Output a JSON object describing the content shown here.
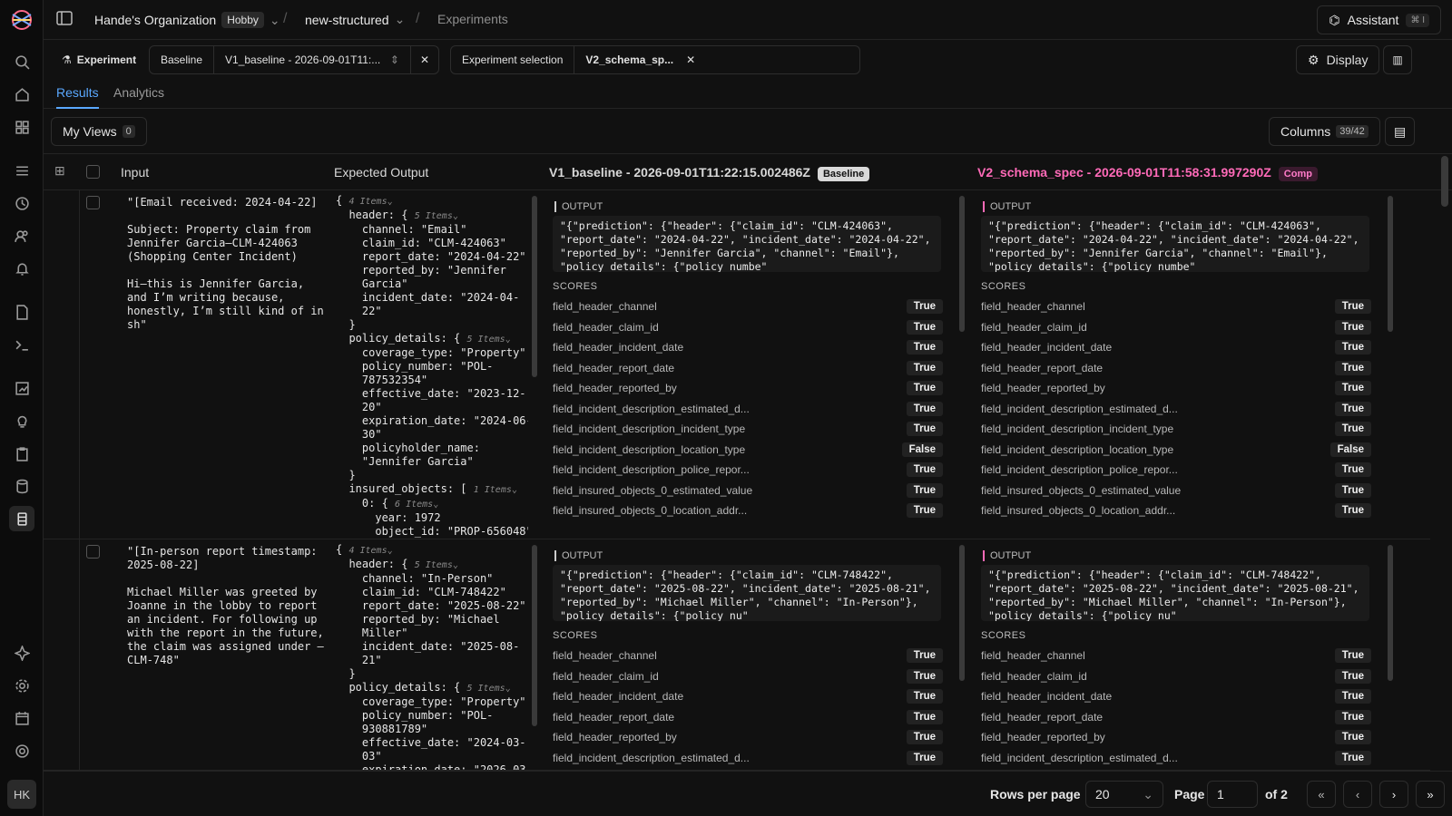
{
  "topbar": {
    "org": "Hande's Organization",
    "plan_badge": "Hobby",
    "project": "new-structured",
    "page": "Experiments",
    "assistant_label": "Assistant",
    "assistant_shortcut": "⌘ I"
  },
  "filters": {
    "experiment_label": "Experiment",
    "baseline_label": "Baseline",
    "baseline_value": "V1_baseline - 2026-09-01T11:...",
    "selection_label": "Experiment selection",
    "selection_chip": "V2_schema_sp...",
    "display_label": "Display"
  },
  "tabs": [
    {
      "label": "Results",
      "active": true
    },
    {
      "label": "Analytics",
      "active": false
    }
  ],
  "views": {
    "label": "My Views",
    "count": "0",
    "columns_label": "Columns",
    "columns_count": "39/42"
  },
  "columns": {
    "input": "Input",
    "expected": "Expected Output",
    "baseline": "V1_baseline - 2026-09-01T11:22:15.002486Z",
    "baseline_pill": "Baseline",
    "compare": "V2_schema_spec - 2026-09-01T11:58:31.997290Z",
    "compare_pill": "Comp"
  },
  "output_label": "OUTPUT",
  "scores_label": "SCORES",
  "rows": [
    {
      "input": "\"[Email received: 2024-04-22]\n\nSubject: Property claim from Jennifer Garcia—CLM-424063 (Shopping Center Incident)\n\nHi—this is Jennifer Garcia, and I’m writing because, honestly, I’m still kind of in sh\"",
      "expected": [
        {
          "t": "{ ",
          "m": "4 Items"
        },
        {
          "t": "  header: { ",
          "m": "5 Items"
        },
        {
          "t": "    channel: \"Email\""
        },
        {
          "t": "    claim_id: \"CLM-424063\""
        },
        {
          "t": "    report_date: \"2024-04-22\""
        },
        {
          "t": "    reported_by: \"Jennifer"
        },
        {
          "t": "    Garcia\""
        },
        {
          "t": "    incident_date: \"2024-04-"
        },
        {
          "t": "    22\""
        },
        {
          "t": "  }"
        },
        {
          "t": "  policy_details: { ",
          "m": "5 Items"
        },
        {
          "t": "    coverage_type: \"Property\""
        },
        {
          "t": "    policy_number: \"POL-"
        },
        {
          "t": "    787532354\""
        },
        {
          "t": "    effective_date: \"2023-12-"
        },
        {
          "t": "    20\""
        },
        {
          "t": "    expiration_date: \"2024-06-"
        },
        {
          "t": "    30\""
        },
        {
          "t": "    policyholder_name:"
        },
        {
          "t": "    \"Jennifer Garcia\""
        },
        {
          "t": "  }"
        },
        {
          "t": "  insured_objects: [ ",
          "m": "1 Items"
        },
        {
          "t": "    0: { ",
          "m": "6 Items"
        },
        {
          "t": "      year: 1972"
        },
        {
          "t": "      object_id: \"PROP-656048\""
        }
      ],
      "baseline_output": "\"{\"prediction\": {\"header\": {\"claim_id\": \"CLM-424063\",\n\"report_date\": \"2024-04-22\", \"incident_date\": \"2024-04-22\",\n\"reported_by\": \"Jennifer Garcia\", \"channel\": \"Email\"},\n\"policy_details\": {\"policy_numbe\"",
      "compare_output": "\"{\"prediction\": {\"header\": {\"claim_id\": \"CLM-424063\",\n\"report_date\": \"2024-04-22\", \"incident_date\": \"2024-04-22\",\n\"reported_by\": \"Jennifer Garcia\", \"channel\": \"Email\"},\n\"policy_details\": {\"policy_numbe\"",
      "scores": [
        {
          "name": "field_header_channel",
          "b": "True",
          "c": "True"
        },
        {
          "name": "field_header_claim_id",
          "b": "True",
          "c": "True"
        },
        {
          "name": "field_header_incident_date",
          "b": "True",
          "c": "True"
        },
        {
          "name": "field_header_report_date",
          "b": "True",
          "c": "True"
        },
        {
          "name": "field_header_reported_by",
          "b": "True",
          "c": "True"
        },
        {
          "name": "field_incident_description_estimated_d...",
          "b": "True",
          "c": "True"
        },
        {
          "name": "field_incident_description_incident_type",
          "b": "True",
          "c": "True"
        },
        {
          "name": "field_incident_description_location_type",
          "b": "False",
          "c": "False"
        },
        {
          "name": "field_incident_description_police_repor...",
          "b": "True",
          "c": "True"
        },
        {
          "name": "field_insured_objects_0_estimated_value",
          "b": "True",
          "c": "True"
        },
        {
          "name": "field_insured_objects_0_location_addr...",
          "b": "True",
          "c": "True"
        }
      ]
    },
    {
      "input": "\"[In-person report timestamp: 2025-08-22]\n\nMichael Miller was greeted by Joanne in the lobby to report an incident. For following up with the report in the future, the claim was assigned under —CLM-748\"",
      "expected": [
        {
          "t": "{ ",
          "m": "4 Items"
        },
        {
          "t": "  header: { ",
          "m": "5 Items"
        },
        {
          "t": "    channel: \"In-Person\""
        },
        {
          "t": "    claim_id: \"CLM-748422\""
        },
        {
          "t": "    report_date: \"2025-08-22\""
        },
        {
          "t": "    reported_by: \"Michael"
        },
        {
          "t": "    Miller\""
        },
        {
          "t": "    incident_date: \"2025-08-"
        },
        {
          "t": "    21\""
        },
        {
          "t": "  }"
        },
        {
          "t": "  policy_details: { ",
          "m": "5 Items"
        },
        {
          "t": "    coverage_type: \"Property\""
        },
        {
          "t": "    policy_number: \"POL-"
        },
        {
          "t": "    930881789\""
        },
        {
          "t": "    effective_date: \"2024-03-"
        },
        {
          "t": "    03\""
        },
        {
          "t": "    expiration_date: \"2026-03-"
        }
      ],
      "baseline_output": "\"{\"prediction\": {\"header\": {\"claim_id\": \"CLM-748422\",\n\"report_date\": \"2025-08-22\", \"incident_date\": \"2025-08-21\",\n\"reported_by\": \"Michael Miller\", \"channel\": \"In-Person\"},\n\"policy_details\": {\"policy_nu\"",
      "compare_output": "\"{\"prediction\": {\"header\": {\"claim_id\": \"CLM-748422\",\n\"report_date\": \"2025-08-22\", \"incident_date\": \"2025-08-21\",\n\"reported_by\": \"Michael Miller\", \"channel\": \"In-Person\"},\n\"policy_details\": {\"policy_nu\"",
      "scores": [
        {
          "name": "field_header_channel",
          "b": "True",
          "c": "True"
        },
        {
          "name": "field_header_claim_id",
          "b": "True",
          "c": "True"
        },
        {
          "name": "field_header_incident_date",
          "b": "True",
          "c": "True"
        },
        {
          "name": "field_header_report_date",
          "b": "True",
          "c": "True"
        },
        {
          "name": "field_header_reported_by",
          "b": "True",
          "c": "True"
        },
        {
          "name": "field_incident_description_estimated_d...",
          "b": "True",
          "c": "True"
        }
      ]
    }
  ],
  "pager": {
    "rows_label": "Rows per page",
    "rows_value": "20",
    "page_label": "Page",
    "page_value": "1",
    "of_label": "of 2"
  }
}
